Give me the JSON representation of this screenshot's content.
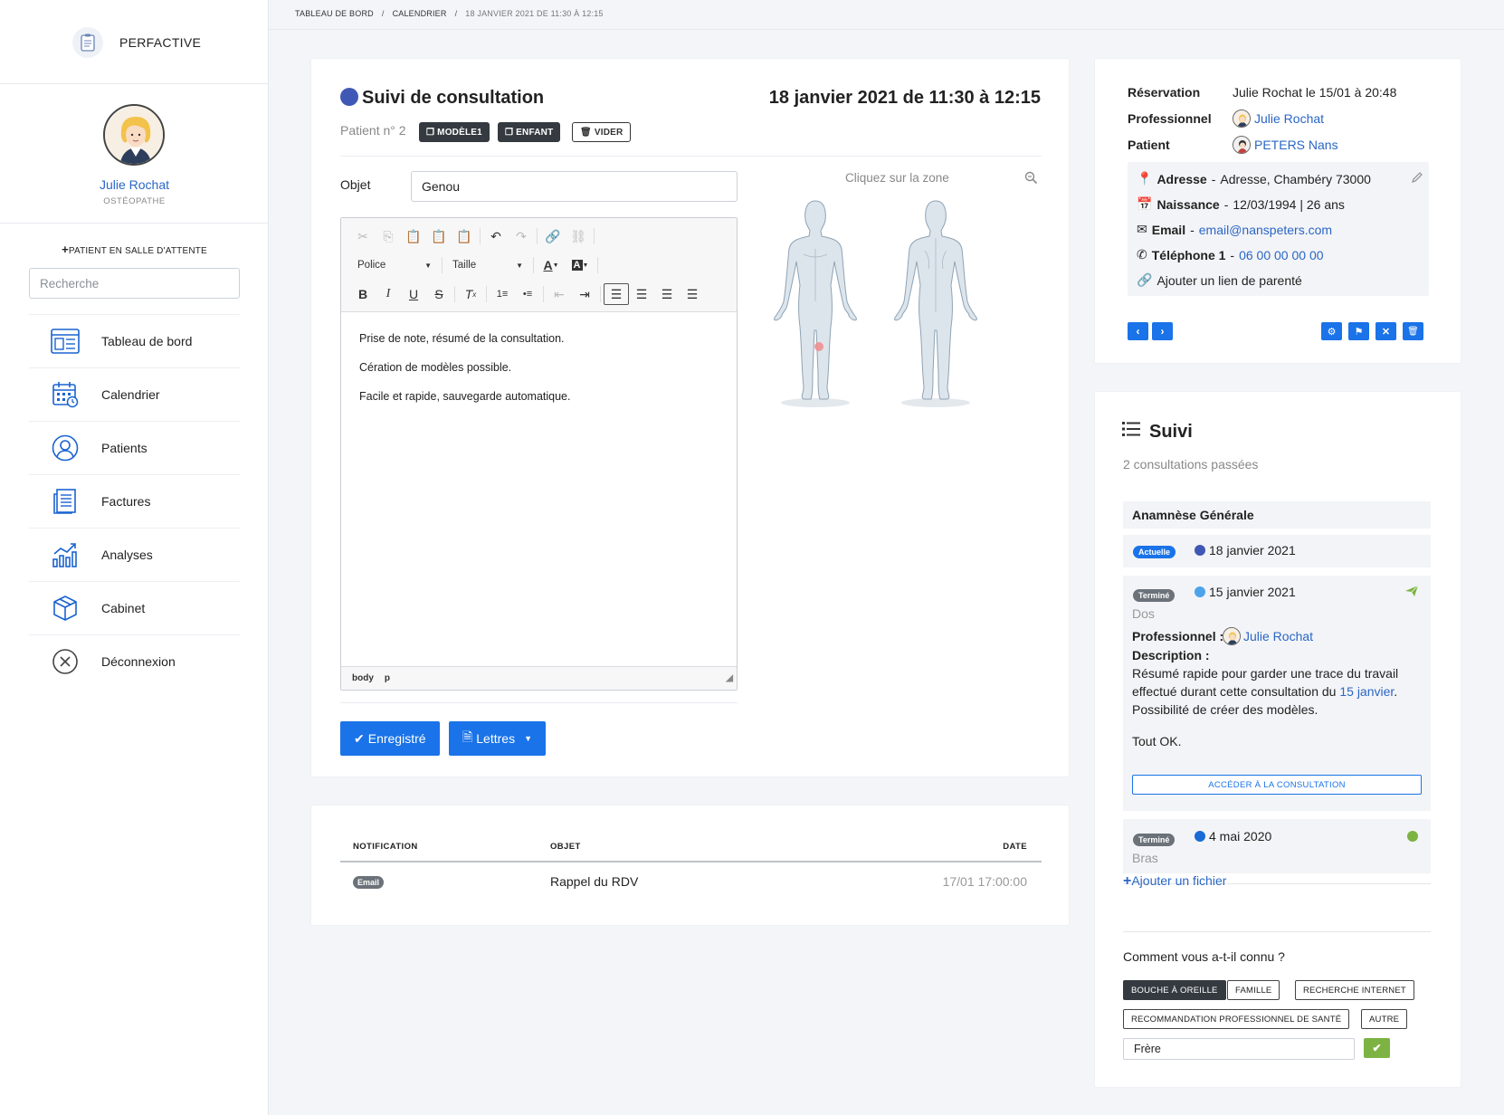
{
  "app": {
    "name": "PERFACTIVE"
  },
  "user": {
    "name": "Julie Rochat",
    "role": "OSTÉOPATHE"
  },
  "sidebar": {
    "waiting_label": "PATIENT EN SALLE D'ATTENTE",
    "search_placeholder": "Recherche",
    "items": [
      {
        "label": "Tableau de bord",
        "icon": "dashboard-icon"
      },
      {
        "label": "Calendrier",
        "icon": "calendar-icon"
      },
      {
        "label": "Patients",
        "icon": "user-icon"
      },
      {
        "label": "Factures",
        "icon": "invoice-icon"
      },
      {
        "label": "Analyses",
        "icon": "chart-icon"
      },
      {
        "label": "Cabinet",
        "icon": "box-icon"
      },
      {
        "label": "Déconnexion",
        "icon": "logout-icon"
      }
    ]
  },
  "breadcrumb": [
    "TABLEAU DE BORD",
    "CALENDRIER",
    "18 JANVIER 2021 DE 11:30 À 12:15"
  ],
  "consultation": {
    "title": "Suivi de consultation",
    "date": "18 janvier 2021 de 11:30 à 12:15",
    "patient_no": "Patient n° 2",
    "tags": [
      "MODÈLE1",
      "ENFANT",
      "VIDER"
    ],
    "object_label": "Objet",
    "object_value": "Genou",
    "editor": {
      "font_label": "Police",
      "size_label": "Taille",
      "paragraphs": [
        "Prise de note, résumé de la consultation.",
        "Cération de modèles possible.",
        "Facile et rapide, sauvegarde automatique."
      ],
      "status_path": [
        "body",
        "p"
      ]
    },
    "save_label": "Enregistré",
    "letters_label": "Lettres",
    "body_map_hint": "Cliquez sur la zone"
  },
  "notifications": {
    "headers": [
      "NOTIFICATION",
      "OBJET",
      "DATE"
    ],
    "rows": [
      {
        "type": "Email",
        "object": "Rappel du RDV",
        "date": "17/01 17:00:00"
      }
    ]
  },
  "reservation": {
    "rows": [
      {
        "key": "Réservation",
        "value": "Julie Rochat le 15/01 à 20:48"
      },
      {
        "key": "Professionnel",
        "value": "Julie Rochat"
      },
      {
        "key": "Patient",
        "value": "PETERS Nans"
      }
    ],
    "address_label": "Adresse",
    "address_value": "Adresse, Chambéry 73000",
    "birth_label": "Naissance",
    "birth_value": "12/03/1994 | 26 ans",
    "email_label": "Email",
    "email_value": "email@nanspeters.com",
    "phone_label": "Téléphone 1",
    "phone_value": "06 00 00 00 00",
    "add_relation": "Ajouter un lien de parenté"
  },
  "suivi": {
    "title": "Suivi",
    "subtitle": "2 consultations passées",
    "anamnese": "Anamnèse Générale",
    "entries": [
      {
        "status": "Actuelle",
        "date": "18 janvier 2021",
        "color": "#4058b5"
      },
      {
        "status": "Terminé",
        "date": "15 janvier 2021",
        "color": "#4da3ea",
        "zone": "Dos",
        "pro_label": "Professionnel :",
        "pro_name": "Julie Rochat",
        "desc_label": "Description :",
        "desc_line1": "Résumé rapide pour garder une trace du travail",
        "desc_line2_before": "effectué durant cette consultation du ",
        "desc_line2_link": "15 janvier",
        "desc_line2_after": ".",
        "desc_line3": "Possibilité de créer des modèles.",
        "desc_line4": "Tout OK.",
        "access_label": "ACCÉDER À LA CONSULTATION"
      },
      {
        "status": "Terminé",
        "date": "4 mai 2020",
        "color": "#1a6ad6",
        "zone": "Bras"
      }
    ],
    "add_file": "Ajouter un fichier",
    "question": "Comment vous a-t-il connu ?",
    "options": [
      "BOUCHE À OREILLE",
      "FAMILLE",
      "RECHERCHE INTERNET",
      "RECOMMANDATION PROFESSIONNEL DE SANTÉ",
      "AUTRE"
    ],
    "selected_option": "BOUCHE À OREILLE",
    "other_value": "Frère"
  },
  "colors": {
    "primary": "#1a73e8",
    "link": "#2a66c5",
    "dark": "#343a40",
    "success": "#7cb342"
  }
}
